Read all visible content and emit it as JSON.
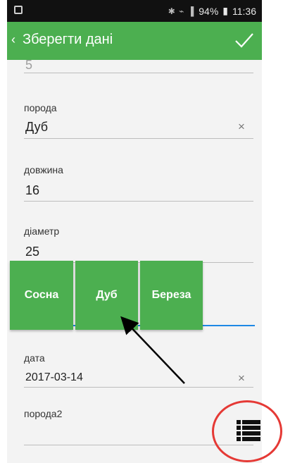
{
  "status": {
    "signal_glyphs": "✱ ⌁ ▐",
    "battery": "94%",
    "time": "11:36"
  },
  "toolbar": {
    "back_glyph": "‹",
    "title": "Зберегти дані",
    "confirm_icon": "check-icon"
  },
  "form": {
    "top_partial_value": "5",
    "fields": [
      {
        "label": "порода",
        "value": "Дуб",
        "clear": "×"
      },
      {
        "label": "довжина",
        "value": "16"
      },
      {
        "label": "діаметр",
        "value": "25"
      },
      {
        "label": "дата",
        "value": "2017-03-14",
        "clear": "×"
      },
      {
        "label": "порода2",
        "value": ""
      }
    ]
  },
  "suggestions": [
    "Сосна",
    "Дуб",
    "Береза"
  ],
  "colors": {
    "accent": "#4caf50",
    "focus": "#1e88e5",
    "annotation": "#e53935"
  }
}
